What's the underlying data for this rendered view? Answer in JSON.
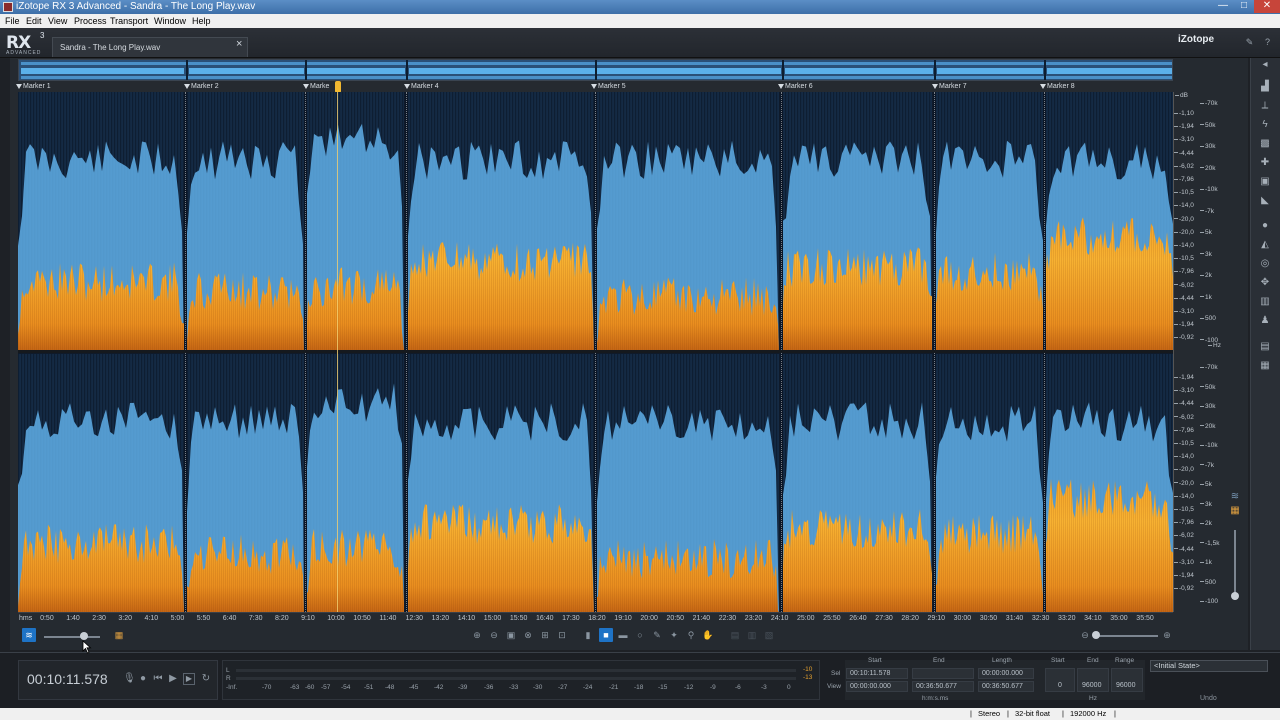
{
  "window": {
    "title": "iZotope RX 3 Advanced - Sandra - The Long Play.wav",
    "min": "—",
    "max": "□",
    "close": "✕"
  },
  "menu": [
    "File",
    "Edit",
    "View",
    "Process",
    "Transport",
    "Window",
    "Help"
  ],
  "header": {
    "logo": "RX",
    "logo_sup": "3",
    "logo_sub": "ADVANCED",
    "file_tab": "Sandra - The Long Play.wav",
    "tab_close": "×",
    "brand": "iZotope"
  },
  "markers": [
    "Marker 1",
    "Marker 2",
    "Marker 3",
    "Marker 4",
    "Marker 5",
    "Marker 6",
    "Marker 7",
    "Marker 8"
  ],
  "marker3_visible_label": "Marke",
  "scale": {
    "unit_top": "dB",
    "db_top": [
      "-1,10",
      "-1,94",
      "-3,10",
      "-4,44",
      "-6,02",
      "-7,96",
      "-10,5",
      "-14,0",
      "-20,0",
      "-20,0",
      "-14,0",
      "-10,5",
      "-7,96",
      "-6,02",
      "-4,44",
      "-3,10",
      "-1,94",
      "-0,92"
    ],
    "hz_top": [
      "-70k",
      "50k",
      "30k",
      "20k",
      "-10k",
      "-7k",
      "5k",
      "3k",
      "2k",
      "1k",
      "500",
      "-100"
    ],
    "hz_unit": "Hz",
    "db_bottom": [
      "-1,94",
      "-3,10",
      "-4,44",
      "-6,02",
      "-7,96",
      "-10,5",
      "-14,0",
      "-20,0",
      "-20,0",
      "-14,0",
      "-10,5",
      "-7,96",
      "-6,02",
      "-4,44",
      "-3,10",
      "-1,94",
      "-0,92"
    ],
    "hz_bottom": [
      "-70k",
      "50k",
      "30k",
      "20k",
      "-10k",
      "-7k",
      "5k",
      "3k",
      "2k",
      "-1,5k",
      "1k",
      "500",
      "-100"
    ]
  },
  "time_ruler": [
    "hms",
    "0:50",
    "1:40",
    "2:30",
    "3:20",
    "4:10",
    "5:00",
    "5:50",
    "6:40",
    "7:30",
    "8:20",
    "9:10",
    "10:00",
    "10:50",
    "11:40",
    "12:30",
    "13:20",
    "14:10",
    "15:00",
    "15:50",
    "16:40",
    "17:30",
    "18:20",
    "19:10",
    "20:00",
    "20:50",
    "21:40",
    "22:30",
    "23:20",
    "24:10",
    "25:00",
    "25:50",
    "26:40",
    "27:30",
    "28:20",
    "29:10",
    "30:00",
    "30:50",
    "31:40",
    "32:30",
    "33:20",
    "34:10",
    "35:00",
    "35:50"
  ],
  "transport": {
    "timecode": "00:10:11.578",
    "buttons": [
      "mic-icon",
      "record-icon",
      "rewind-icon",
      "play-icon",
      "play-selection-icon",
      "loop-icon"
    ]
  },
  "meter": {
    "left_label": "L",
    "right_label": "R",
    "peak_l": "-10",
    "peak_r": "-13",
    "scale": [
      "-Inf.",
      "-70",
      "-63",
      "-60",
      "-57",
      "-54",
      "-51",
      "-48",
      "-45",
      "-42",
      "-39",
      "-36",
      "-33",
      "-30",
      "-27",
      "-24",
      "-21",
      "-18",
      "-15",
      "-12",
      "-9",
      "-6",
      "-3",
      "0"
    ]
  },
  "selection": {
    "headers": [
      "Start",
      "End",
      "Length",
      "Start",
      "End",
      "Range"
    ],
    "sel_label": "Sel",
    "view_label": "View",
    "sel_start": "00:10:11.578",
    "sel_end": "",
    "sel_length": "00:00:00.000",
    "view_start": "00:00:00.000",
    "view_end": "00:36:50.677",
    "view_length": "00:36:50.677",
    "freq_start": "0",
    "freq_end": "96000",
    "freq_range": "96000",
    "time_unit": "h:m:s.ms",
    "freq_unit": "Hz"
  },
  "history": {
    "state": "<Initial State>",
    "undo": "Undo"
  },
  "status": {
    "channels": "Stereo",
    "bit_depth": "32-bit float",
    "sample_rate": "192000 Hz"
  },
  "colors": {
    "spectro_blue": "#5aa2d6",
    "spectro_orange": "#f0921e",
    "playhead": "#f2b830",
    "accent": "#1e73c6"
  }
}
